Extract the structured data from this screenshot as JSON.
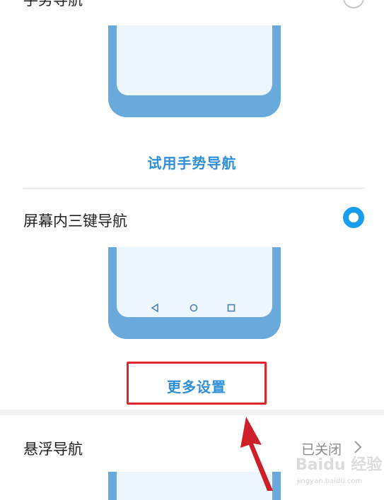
{
  "gesture_nav": {
    "title": "手势导航",
    "selected": false,
    "try_link": "试用手势导航"
  },
  "three_key_nav": {
    "title": "屏幕内三键导航",
    "selected": true,
    "more_settings": "更多设置"
  },
  "floating_nav": {
    "title": "悬浮导航",
    "status": "已关闭"
  },
  "watermark": "Baidu 经验",
  "watermark_url": "jingyan.baidu.com",
  "colors": {
    "accent": "#1a9cf0",
    "link": "#2f8fd8",
    "highlight_box": "#e0252b",
    "arrow": "#cc1f2a"
  }
}
